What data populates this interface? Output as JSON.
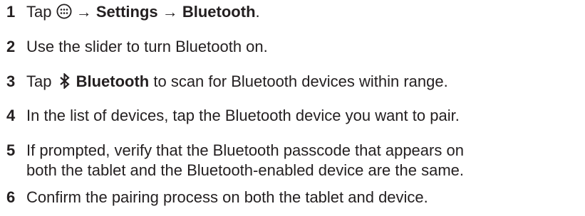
{
  "steps": [
    {
      "number": "1",
      "t1": "Tap ",
      "t2": " → ",
      "settings": "Settings",
      "arrow2": " → ",
      "bluetooth": "Bluetooth",
      "end": ".",
      "icon": "apps-grid-icon"
    },
    {
      "number": "2",
      "text": "Use the slider to turn Bluetooth on."
    },
    {
      "number": "3",
      "t1": "Tap ",
      "bluetooth": "Bluetooth",
      "rest": " to scan for Bluetooth devices within range.",
      "icon": "bluetooth-icon"
    },
    {
      "number": "4",
      "text": "In the list of devices, tap the Bluetooth device you want to pair."
    },
    {
      "number": "5",
      "line1": "If prompted, verify that the Bluetooth passcode that appears on",
      "line2": "both the tablet and the Bluetooth-enabled device are the same."
    },
    {
      "number": "6",
      "text": "Confirm the pairing process on both the tablet and device."
    }
  ],
  "colors": {
    "text": "#231f20",
    "background": "#ffffff"
  }
}
